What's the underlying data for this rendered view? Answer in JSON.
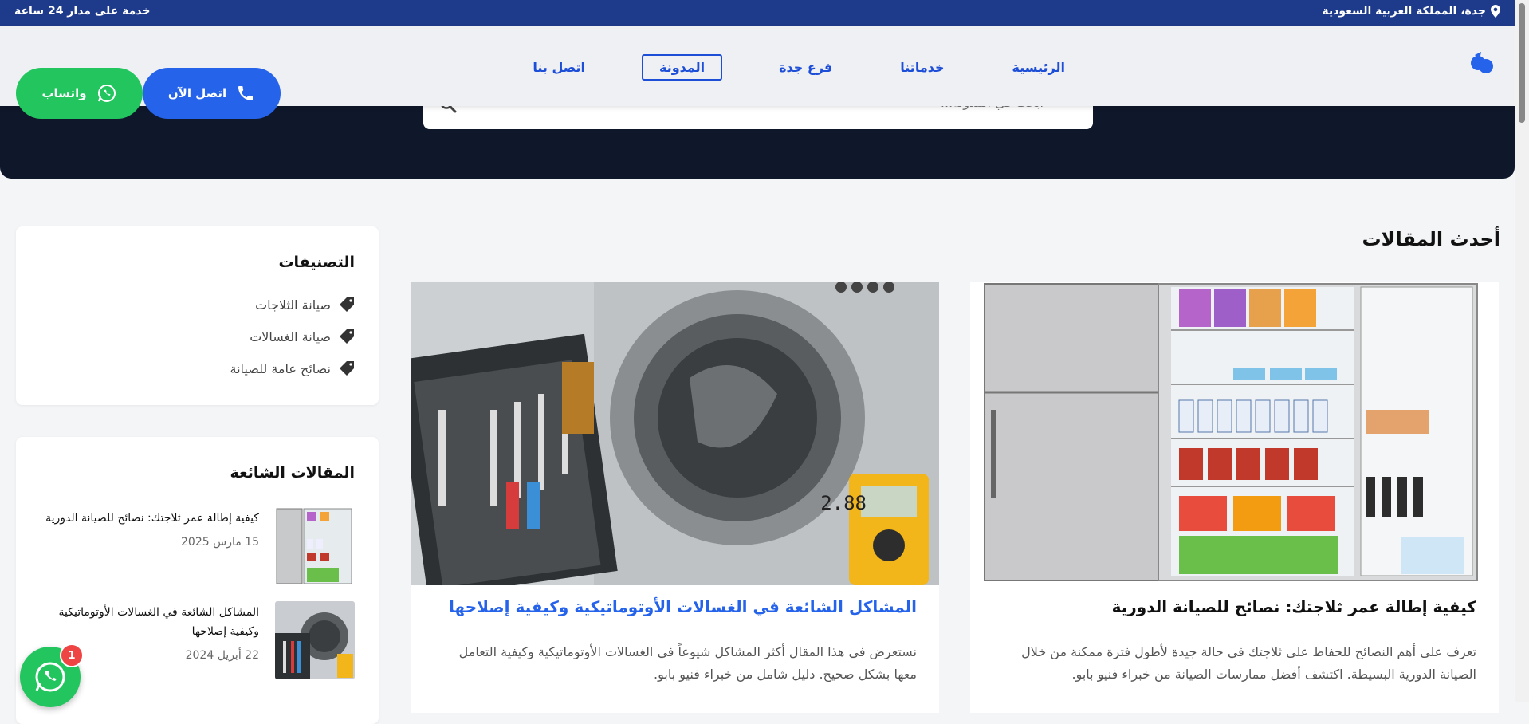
{
  "topbar": {
    "location": "جدة، المملكة العربية السعودية",
    "hours": "خدمة على مدار 24 ساعة"
  },
  "search": {
    "placeholder": "ابحث في المدونة..."
  },
  "nav": {
    "links": [
      {
        "label": "الرئيسية"
      },
      {
        "label": "خدماتنا"
      },
      {
        "label": "فرع جدة"
      },
      {
        "label": "المدونة",
        "active": true
      },
      {
        "label": "اتصل بنا"
      }
    ],
    "call_label": "اتصل الآن",
    "whatsapp_label": "واتساب"
  },
  "main": {
    "section_title": "أحدث المقالات",
    "articles": [
      {
        "title": "كيفية إطالة عمر ثلاجتك: نصائح للصيانة الدورية",
        "excerpt": "تعرف على أهم النصائح للحفاظ على ثلاجتك في حالة جيدة لأطول فترة ممكنة من خلال الصيانة الدورية البسيطة. اكتشف أفضل ممارسات الصيانة من خبراء فنيو بابو."
      },
      {
        "title": "المشاكل الشائعة في الغسالات الأوتوماتيكية وكيفية إصلاحها",
        "excerpt": "نستعرض في هذا المقال أكثر المشاكل شيوعاً في الغسالات الأوتوماتيكية وكيفية التعامل معها بشكل صحيح. دليل شامل من خبراء فنيو بابو."
      }
    ]
  },
  "sidebar": {
    "categories_title": "التصنيفات",
    "categories": [
      {
        "label": "صيانة الثلاجات"
      },
      {
        "label": "صيانة الغسالات"
      },
      {
        "label": "نصائح عامة للصيانة"
      }
    ],
    "popular_title": "المقالات الشائعة",
    "popular": [
      {
        "title": "كيفية إطالة عمر ثلاجتك: نصائح للصيانة الدورية",
        "date": "15 مارس 2025"
      },
      {
        "title": "المشاكل الشائعة في الغسالات الأوتوماتيكية وكيفية إصلاحها",
        "date": "22 أبريل 2024"
      }
    ]
  },
  "floating": {
    "badge": "1"
  },
  "colors": {
    "brand_blue": "#2563eb",
    "whatsapp_green": "#22c55e",
    "topbar": "#1e3a8a",
    "hero": "#0f172a"
  }
}
